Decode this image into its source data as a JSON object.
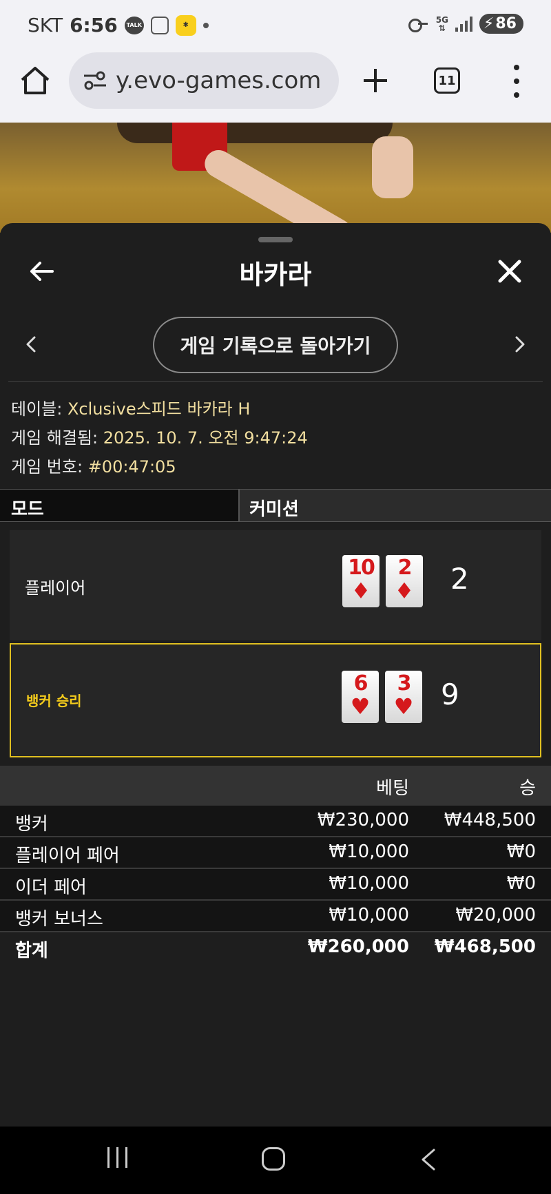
{
  "status_bar": {
    "carrier": "SKT",
    "time": "6:56",
    "talk_label": "TALK",
    "battery": "86",
    "network": "5G"
  },
  "browser": {
    "url": "y.evo-games.com",
    "tab_count": "11"
  },
  "sheet": {
    "title": "바카라",
    "history_button": "게임 기록으로 돌아가기"
  },
  "info": {
    "table_label": "테이블:",
    "table_value": "Xclusive스피드 바카라 H",
    "resolved_label": "게임 해결됨:",
    "resolved_value": "2025. 10. 7. 오전 9:47:24",
    "game_no_label": "게임 번호:",
    "game_no_value": "#00:47:05"
  },
  "mode": {
    "mode_label": "모드",
    "commission_label": "커미션"
  },
  "hands": {
    "player": {
      "label": "플레이어",
      "score": "2",
      "cards": [
        {
          "rank": "10",
          "suit": "♦"
        },
        {
          "rank": "2",
          "suit": "♦"
        }
      ]
    },
    "banker": {
      "label": "뱅커 승리",
      "score": "9",
      "cards": [
        {
          "rank": "6",
          "suit": "♥"
        },
        {
          "rank": "3",
          "suit": "♥"
        }
      ]
    }
  },
  "bets": {
    "header_bet": "베팅",
    "header_win": "승",
    "rows": [
      {
        "name": "뱅커",
        "bet": "₩230,000",
        "win": "₩448,500"
      },
      {
        "name": "플레이어 페어",
        "bet": "₩10,000",
        "win": "₩0"
      },
      {
        "name": "이더 페어",
        "bet": "₩10,000",
        "win": "₩0"
      },
      {
        "name": "뱅커 보너스",
        "bet": "₩10,000",
        "win": "₩20,000"
      }
    ],
    "total": {
      "name": "합계",
      "bet": "₩260,000",
      "win": "₩468,500"
    }
  },
  "colors": {
    "accent_yellow": "#f5cc1c",
    "card_red": "#d5191c",
    "info_value": "#f2dfa0"
  }
}
